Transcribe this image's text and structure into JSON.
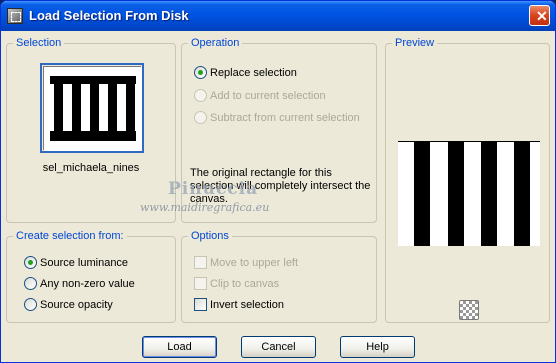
{
  "window": {
    "title": "Load Selection From Disk",
    "close_glyph": "✕",
    "icon": "selection-app-icon"
  },
  "selection_group": {
    "label": "Selection",
    "thumbnail_name": "sel_michaela_nines"
  },
  "operation_group": {
    "label": "Operation",
    "options": [
      {
        "label": "Replace selection",
        "checked": true,
        "enabled": true
      },
      {
        "label": "Add to current selection",
        "checked": false,
        "enabled": false
      },
      {
        "label": "Subtract from current selection",
        "checked": false,
        "enabled": false
      }
    ],
    "info": "The original rectangle for this selection will completely intersect the canvas."
  },
  "preview_group": {
    "label": "Preview",
    "checker_icon": "transparency-checker-icon"
  },
  "create_group": {
    "label": "Create selection from:",
    "options": [
      {
        "label": "Source luminance",
        "checked": true
      },
      {
        "label": "Any non-zero value",
        "checked": false
      },
      {
        "label": "Source opacity",
        "checked": false
      }
    ]
  },
  "options_group": {
    "label": "Options",
    "options": [
      {
        "label": "Move to upper left",
        "checked": false,
        "enabled": false
      },
      {
        "label": "Clip to canvas",
        "checked": false,
        "enabled": false
      },
      {
        "label": "Invert selection",
        "checked": false,
        "enabled": true
      }
    ]
  },
  "buttons": {
    "load": "Load",
    "cancel": "Cancel",
    "help": "Help"
  },
  "watermark": {
    "line1": "Pinuccia",
    "line2": "www.maidiregrafica.eu"
  }
}
